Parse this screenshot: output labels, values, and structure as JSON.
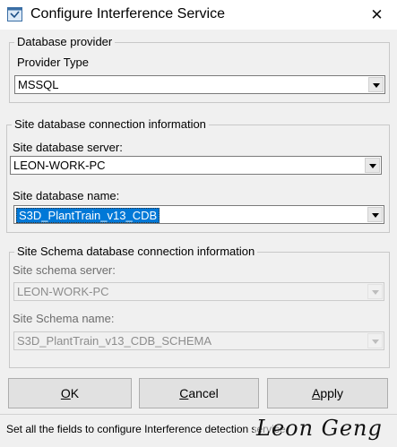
{
  "window": {
    "title": "Configure Interference Service",
    "close_symbol": "✕",
    "app_icon": "config-app-icon"
  },
  "database_provider": {
    "legend": "Database provider",
    "provider_type_label": "Provider Type",
    "provider_type_value": "MSSQL"
  },
  "site_db": {
    "legend": "Site database connection information",
    "server_label": "Site database server:",
    "server_value": "LEON-WORK-PC",
    "name_label": "Site database name:",
    "name_value": "S3D_PlantTrain_v13_CDB"
  },
  "schema_db": {
    "legend": "Site Schema database connection information",
    "server_label": "Site schema server:",
    "server_value": "LEON-WORK-PC",
    "name_label": "Site Schema name:",
    "name_value": "S3D_PlantTrain_v13_CDB_SCHEMA"
  },
  "buttons": {
    "ok": {
      "mnemonic": "O",
      "rest": "K"
    },
    "cancel": {
      "mnemonic": "C",
      "rest": "ancel"
    },
    "apply": {
      "mnemonic": "A",
      "rest": "pply"
    }
  },
  "status_bar": {
    "text": "Set all the fields to configure Interference detection service",
    "signature": "Leon Geng"
  },
  "colors": {
    "selection": "#0078d7",
    "window_bg": "#f0f0f0"
  }
}
